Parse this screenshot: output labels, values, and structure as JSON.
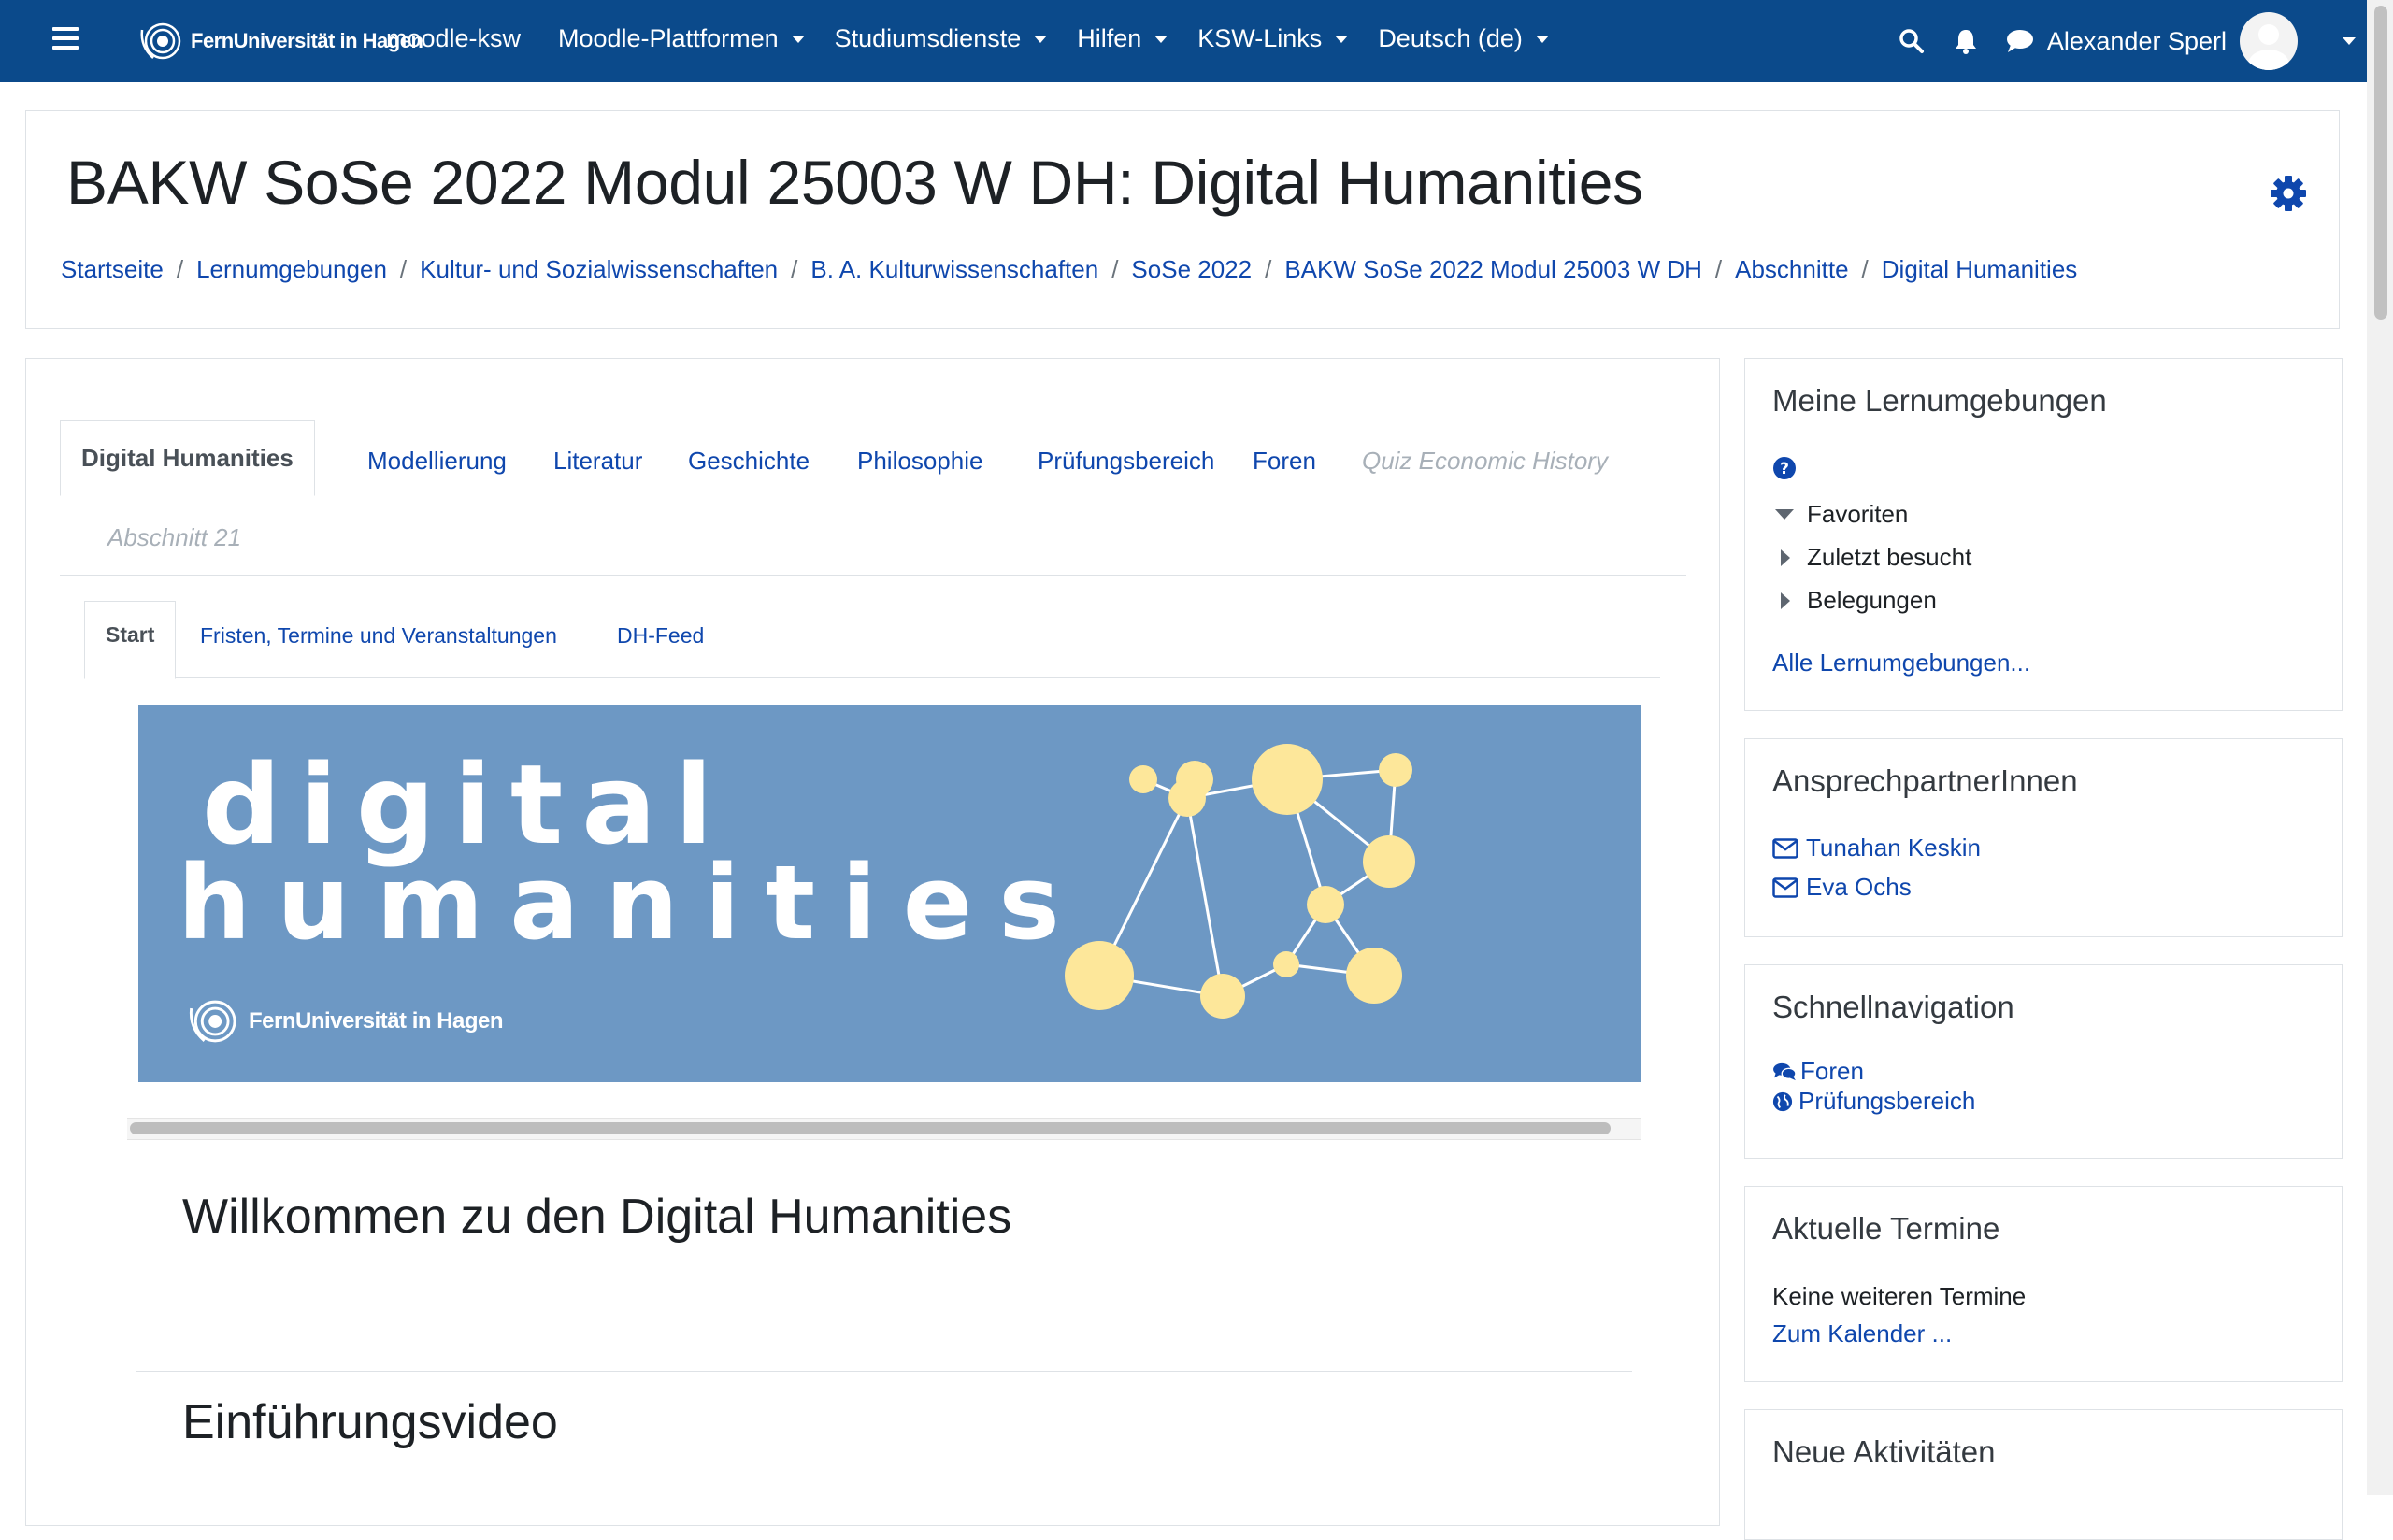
{
  "navbar": {
    "brand": "FernUniversität in Hagen",
    "site_name": "moodle-ksw",
    "menu": [
      "Moodle-Plattformen",
      "Studiumsdienste",
      "Hilfen",
      "KSW-Links",
      "Deutsch (de)"
    ],
    "user_name": "Alexander Sperl"
  },
  "header": {
    "title": "BAKW SoSe 2022 Modul 25003 W DH: Digital Humanities",
    "breadcrumb": [
      "Startseite",
      "Lernumgebungen",
      "Kultur- und Sozialwissenschaften",
      "B. A. Kulturwissenschaften",
      "SoSe 2022",
      "BAKW SoSe 2022 Modul 25003 W DH",
      "Abschnitte",
      "Digital Humanities"
    ]
  },
  "section_tabs": [
    "Digital Humanities",
    "Modellierung",
    "Literatur",
    "Geschichte",
    "Philosophie",
    "Prüfungsbereich",
    "Foren",
    "Quiz Economic History",
    "Abschnitt 21"
  ],
  "sub_tabs": [
    "Start",
    "Fristen, Termine und Veranstaltungen",
    "DH-Feed"
  ],
  "banner": {
    "line1": "digital",
    "line2": "humanities",
    "logo_text": "FernUniversität in Hagen"
  },
  "content": {
    "heading1": "Willkommen zu den Digital Humanities",
    "heading2": "Einführungsvideo"
  },
  "blocks": {
    "courses": {
      "title": "Meine Lernumgebungen",
      "items": [
        "Favoriten",
        "Zuletzt besucht",
        "Belegungen"
      ],
      "link": "Alle Lernumgebungen..."
    },
    "contacts": {
      "title": "AnsprechpartnerInnen",
      "people": [
        "Tunahan Keskin",
        "Eva Ochs"
      ]
    },
    "quicknav": {
      "title": "Schnellnavigation",
      "links": [
        "Foren",
        "Prüfungsbereich"
      ]
    },
    "events": {
      "title": "Aktuelle Termine",
      "text": "Keine weiteren Termine",
      "link": "Zum Kalender ..."
    },
    "activities": {
      "title": "Neue Aktivitäten"
    }
  },
  "colors": {
    "navbar": "#0b4a8b",
    "link": "#0f47ad",
    "banner_bg": "#6d98c4",
    "banner_nodes": "#fde79a"
  }
}
